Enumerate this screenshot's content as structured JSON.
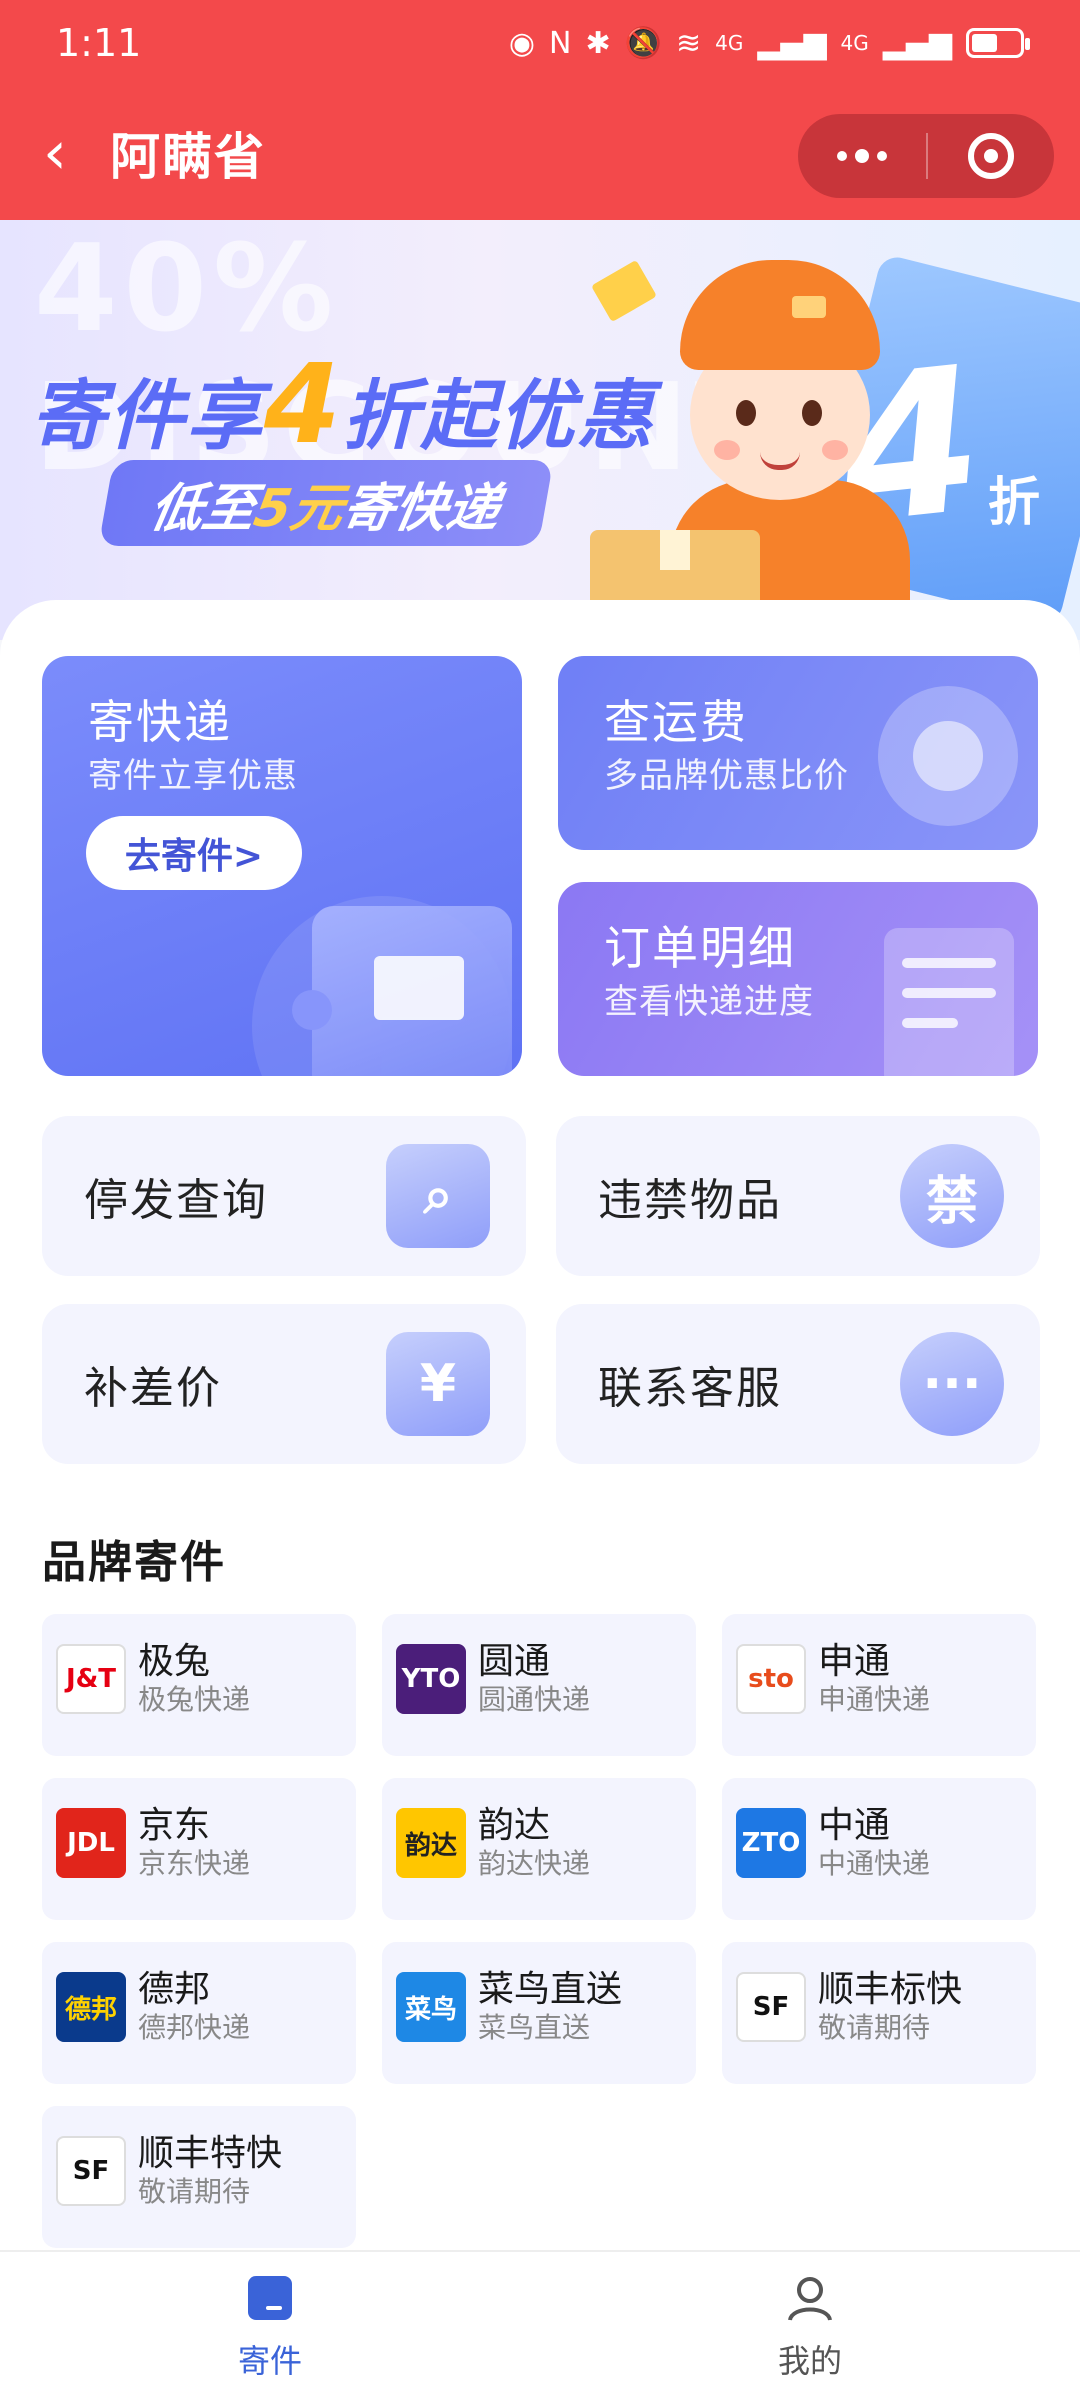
{
  "status_bar": {
    "time": "1:11",
    "network": "4G"
  },
  "titlebar": {
    "back_icon": "chevron-left-icon",
    "title": "阿瞒省"
  },
  "banner": {
    "bg_text": "40% DISCOUNT",
    "title_pre": "寄件享",
    "title_num": "4",
    "title_post": "折起优惠",
    "pill_pre": "低至",
    "pill_num": "5元",
    "pill_post": "寄快递",
    "coupon_num": "4",
    "coupon_unit": "折"
  },
  "cards": {
    "send": {
      "title": "寄快递",
      "subtitle": "寄件立享优惠",
      "button": "去寄件>"
    },
    "fee": {
      "title": "查运费",
      "subtitle": "多品牌优惠比价"
    },
    "orders": {
      "title": "订单明细",
      "subtitle": "查看快递进度"
    }
  },
  "tiles": [
    {
      "label": "停发查询",
      "icon": "search-box-icon"
    },
    {
      "label": "违禁物品",
      "icon": "forbidden-icon",
      "icon_text": "禁"
    },
    {
      "label": "补差价",
      "icon": "yuan-icon",
      "icon_text": "¥"
    },
    {
      "label": "联系客服",
      "icon": "chat-icon"
    }
  ],
  "brands_title": "品牌寄件",
  "brands": [
    {
      "name": "极兔",
      "sub": "极兔快递",
      "logo_text": "J&T",
      "color": "#ffffff",
      "text_color": "#e60012"
    },
    {
      "name": "圆通",
      "sub": "圆通快递",
      "logo_text": "YTO",
      "color": "#4b1e7a",
      "text_color": "#ffffff"
    },
    {
      "name": "申通",
      "sub": "申通快递",
      "logo_text": "sto",
      "color": "#ffffff",
      "text_color": "#e84c1c"
    },
    {
      "name": "京东",
      "sub": "京东快递",
      "logo_text": "JDL",
      "color": "#e1251b",
      "text_color": "#ffffff"
    },
    {
      "name": "韵达",
      "sub": "韵达快递",
      "logo_text": "韵达",
      "color": "#ffc600",
      "text_color": "#222222"
    },
    {
      "name": "中通",
      "sub": "中通快递",
      "logo_text": "ZTO",
      "color": "#1e78e4",
      "text_color": "#ffffff"
    },
    {
      "name": "德邦",
      "sub": "德邦快递",
      "logo_text": "德邦",
      "color": "#0a3a8c",
      "text_color": "#ffd200"
    },
    {
      "name": "菜鸟直送",
      "sub": "菜鸟直送",
      "logo_text": "菜鸟",
      "color": "#1e88e5",
      "text_color": "#ffffff"
    },
    {
      "name": "顺丰标快",
      "sub": "敬请期待",
      "logo_text": "SF",
      "color": "#ffffff",
      "text_color": "#111111"
    },
    {
      "name": "顺丰特快",
      "sub": "敬请期待",
      "logo_text": "SF",
      "color": "#ffffff",
      "text_color": "#111111"
    }
  ],
  "bottom_nav": [
    {
      "label": "寄件",
      "icon": "package-icon",
      "active": true,
      "color": "#3a63d8"
    },
    {
      "label": "我的",
      "icon": "user-icon",
      "active": false,
      "color": "#555555"
    }
  ]
}
